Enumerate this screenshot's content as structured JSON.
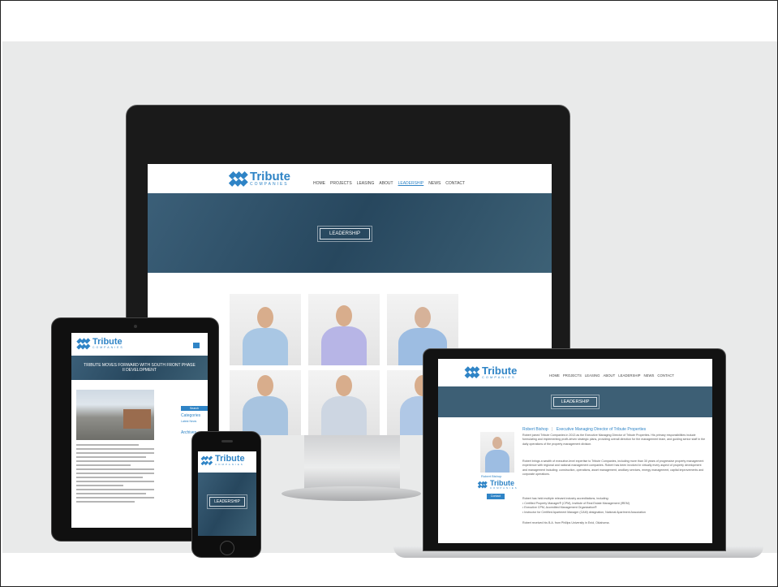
{
  "brand": {
    "name": "Tribute",
    "tagline": "COMPANIES",
    "color": "#2f84c6",
    "hero_color": "#2d4d63"
  },
  "nav": {
    "items": [
      "HOME",
      "PROJECTS",
      "LEASING",
      "ABOUT",
      "LEADERSHIP",
      "NEWS",
      "CONTACT"
    ],
    "active": "LEADERSHIP"
  },
  "monitor": {
    "hero_button": "LEADERSHIP"
  },
  "tablet": {
    "post_title": "TRIBUTE MOVES FORWARD WITH SOUTH FRONT PHASE II DEVELOPMENT",
    "search_button": "Search",
    "categories_heading": "Categories",
    "categories_item": "Latest News",
    "archives_heading": "Archives"
  },
  "phone": {
    "hero_button": "LEADERSHIP"
  },
  "laptop": {
    "hero_button": "LEADERSHIP",
    "person_name": "Robert Bishop",
    "person_title": "Executive Managing Director of Tribute Properties",
    "caption_name": "Robert Bishop",
    "contact_button": "Contact",
    "bio_p1": "Robert joined Tribute Companies in 2013 as the Executive Managing Director of Tribute Properties. His primary responsibilities include formulating and implementing profit-driven strategic plans, providing overall direction for the management team, and guiding senior staff in the daily operations of the property management division.",
    "bio_p2": "Robert brings a wealth of executive-level expertise to Tribute Companies, including more than 30 years of progressive property management experience with regional and national management companies. Robert has been involved in virtually every aspect of property development and management including: construction, operations, asset management, ancillary services, energy management, capital improvements and corporate operations.",
    "bio_p3": "Robert has held multiple relevant industry accreditations, including:",
    "accreditations": [
      "Certified Property Manager® (CPM), Institute of Real Estate Management (IREM)",
      "Executive CPM, Accredited Management Organization®",
      "Instructor for Certified Apartment Manager (CAM) designation, National Apartment Association"
    ],
    "bio_p4": "Robert received his B.A. from Phillips University in Enid, Oklahoma."
  }
}
